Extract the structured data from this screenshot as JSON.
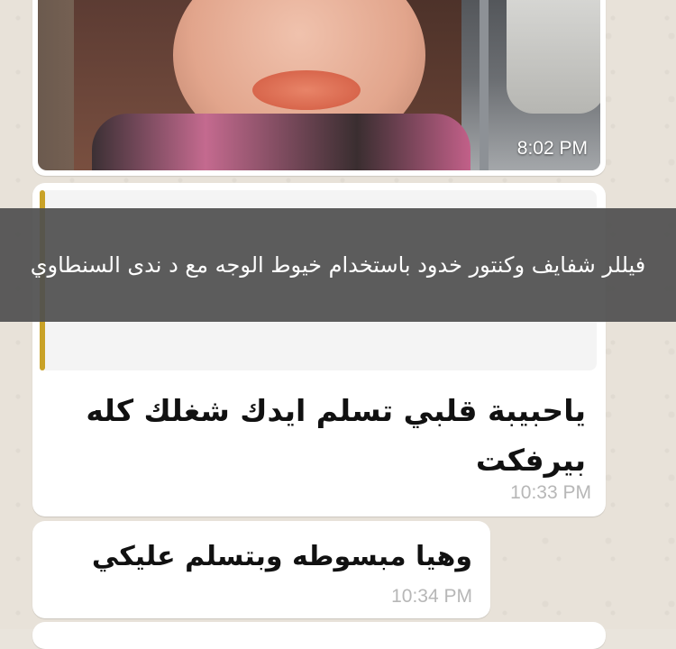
{
  "photo_message": {
    "time": "8:02 PM"
  },
  "quoted_overlay": {
    "text": "فيللر شفايف وكنتور خدود باستخدام خيوط الوجه مع د ندى السنطاوي"
  },
  "messages": [
    {
      "text": "ياحبيبة قلبي تسلم ايدك شغلك كله بيرفكت",
      "time": "10:33 PM"
    },
    {
      "text": "وهيا مبسوطه وبتسلم عليكي",
      "time": "10:34 PM"
    }
  ],
  "colors": {
    "bubble": "#ffffff",
    "quote_bar": "#c9a227",
    "overlay": "#505050",
    "timestamp": "#b7b7b7"
  }
}
